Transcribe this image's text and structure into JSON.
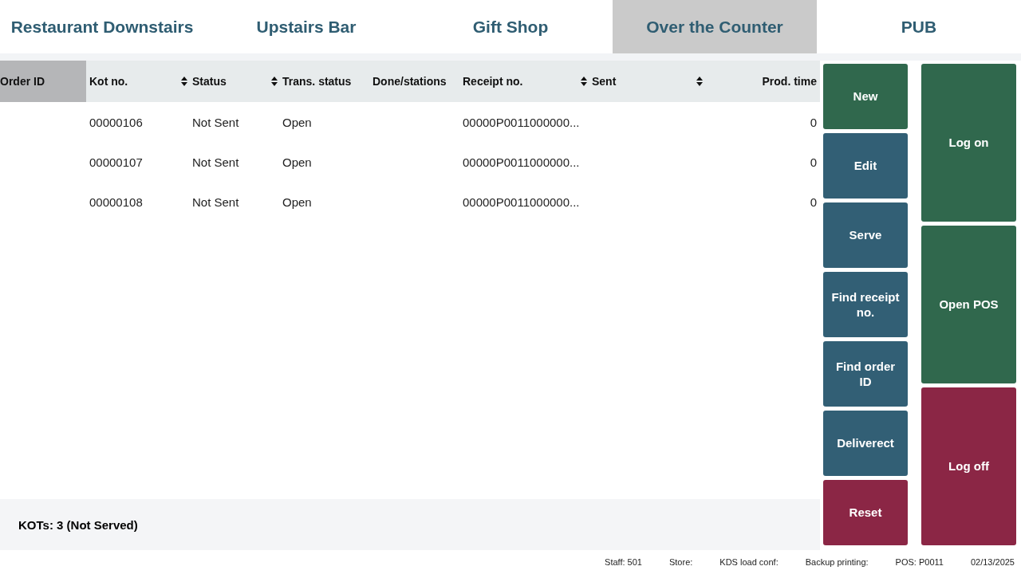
{
  "tabs": [
    {
      "label": "Restaurant Downstairs",
      "selected": false
    },
    {
      "label": "Upstairs Bar",
      "selected": false
    },
    {
      "label": "Gift Shop",
      "selected": false
    },
    {
      "label": "Over the Counter",
      "selected": true
    },
    {
      "label": "PUB",
      "selected": false
    }
  ],
  "table": {
    "columns": [
      {
        "label": "Order ID",
        "selected": true,
        "sortable": false
      },
      {
        "label": "Kot no.",
        "selected": false,
        "sortable": true
      },
      {
        "label": "Status",
        "selected": false,
        "sortable": true
      },
      {
        "label": "Trans. status",
        "selected": false,
        "sortable": false
      },
      {
        "label": "Done/stations",
        "selected": false,
        "sortable": false
      },
      {
        "label": "Receipt no.",
        "selected": false,
        "sortable": true
      },
      {
        "label": "Sent",
        "selected": false,
        "sortable": true
      },
      {
        "label": "Prod. time",
        "selected": false,
        "sortable": false
      }
    ],
    "rows": [
      [
        "",
        "00000106",
        "Not Sent",
        "Open",
        "",
        "00000P0011000000...",
        "",
        "0"
      ],
      [
        "",
        "00000107",
        "Not Sent",
        "Open",
        "",
        "00000P0011000000...",
        "",
        "0"
      ],
      [
        "",
        "00000108",
        "Not Sent",
        "Open",
        "",
        "00000P0011000000...",
        "",
        "0"
      ]
    ]
  },
  "summary": "KOTs: 3 (Not Served)",
  "actions": [
    {
      "label": "New",
      "kind": "primary"
    },
    {
      "label": "Edit",
      "kind": "secondary"
    },
    {
      "label": "Serve",
      "kind": "secondary"
    },
    {
      "label": "Find receipt no.",
      "kind": "secondary"
    },
    {
      "label": "Find order ID",
      "kind": "secondary"
    },
    {
      "label": "Deliverect",
      "kind": "secondary"
    },
    {
      "label": "Reset",
      "kind": "danger"
    }
  ],
  "session_actions": [
    {
      "label": "Log on",
      "kind": "primary"
    },
    {
      "label": "Open POS",
      "kind": "primary"
    },
    {
      "label": "Log off",
      "kind": "danger"
    }
  ],
  "status_bar": [
    "Staff: 501",
    "Store:",
    "KDS load conf:",
    "Backup printing:",
    "POS: P0011",
    "02/13/2025"
  ]
}
